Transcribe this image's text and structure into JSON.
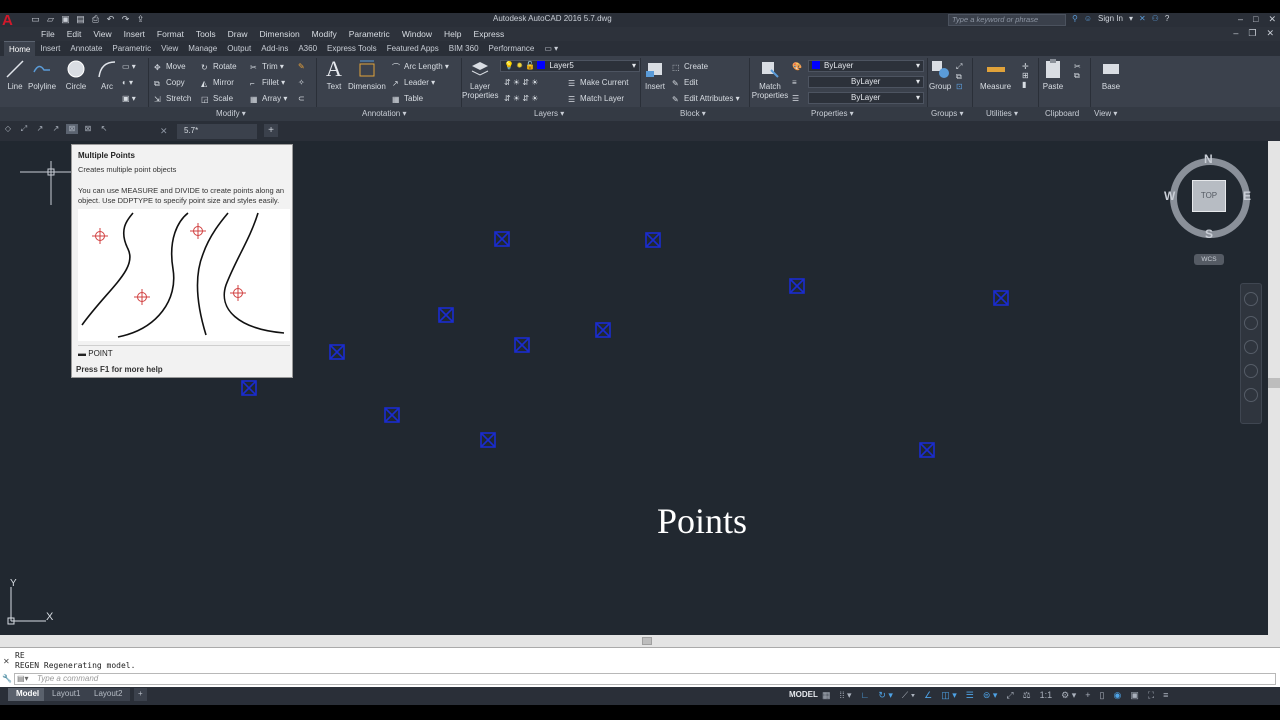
{
  "app": {
    "title": "Autodesk AutoCAD 2016    5.7.dwg",
    "logo": "A",
    "search_placeholder": "Type a keyword or phrase",
    "sign_in": "Sign In"
  },
  "menu": [
    "File",
    "Edit",
    "View",
    "Insert",
    "Format",
    "Tools",
    "Draw",
    "Dimension",
    "Modify",
    "Parametric",
    "Window",
    "Help",
    "Express"
  ],
  "ribbon_tabs": [
    "Home",
    "Insert",
    "Annotate",
    "Parametric",
    "View",
    "Manage",
    "Output",
    "Add-ins",
    "A360",
    "Express Tools",
    "Featured Apps",
    "BIM 360",
    "Performance"
  ],
  "draw": {
    "line": "Line",
    "polyline": "Polyline",
    "circle": "Circle",
    "arc": "Arc"
  },
  "modify": {
    "move": "Move",
    "rotate": "Rotate",
    "trim": "Trim",
    "copy": "Copy",
    "mirror": "Mirror",
    "fillet": "Fillet",
    "stretch": "Stretch",
    "scale": "Scale",
    "array": "Array"
  },
  "annotation": {
    "text": "Text",
    "dimension": "Dimension",
    "arc_length": "Arc Length",
    "leader": "Leader",
    "table": "Table"
  },
  "layers": {
    "layer_properties": "Layer Properties",
    "current_layer": "Layer5",
    "make_current": "Make Current",
    "match_layer": "Match Layer"
  },
  "block": {
    "insert": "Insert",
    "create": "Create",
    "edit": "Edit",
    "edit_attributes": "Edit Attributes"
  },
  "properties": {
    "match_properties": "Match Properties",
    "color": "ByLayer",
    "linetype": "ByLayer",
    "lineweight": "ByLayer"
  },
  "groups": {
    "group": "Group"
  },
  "utilities": {
    "measure": "Measure"
  },
  "clipboard": {
    "paste": "Paste"
  },
  "view": {
    "base": "Base"
  },
  "panel_labels": {
    "modify": "Modify ▾",
    "annotation": "Annotation ▾",
    "layers": "Layers ▾",
    "block": "Block ▾",
    "properties": "Properties ▾",
    "groups": "Groups ▾",
    "utilities": "Utilities ▾",
    "clipboard": "Clipboard",
    "view": "View ▾"
  },
  "file_tab": {
    "name": "5.7*"
  },
  "drawing": {
    "label": "Points"
  },
  "tooltip": {
    "title": "Multiple Points",
    "description": "Creates multiple point objects",
    "body": "You can use MEASURE and DIVIDE to create points along an object. Use DDPTYPE to specify point size and styles easily.",
    "command": "POINT",
    "help": "Press F1 for more help"
  },
  "viewcube": {
    "n": "N",
    "s": "S",
    "e": "E",
    "w": "W",
    "face": "TOP",
    "wcs": "WCS"
  },
  "ucs": {
    "x": "X",
    "y": "Y"
  },
  "command": {
    "history": [
      "RE",
      "REGEN Regenerating model."
    ],
    "placeholder": "Type a command"
  },
  "layout_tabs": [
    "Model",
    "Layout1",
    "Layout2"
  ],
  "status": {
    "model": "MODEL",
    "scale": "1:1"
  },
  "colors": {
    "canvas": "#212830",
    "point_marker": "#1a2ccf",
    "ribbon": "#3b414c"
  }
}
